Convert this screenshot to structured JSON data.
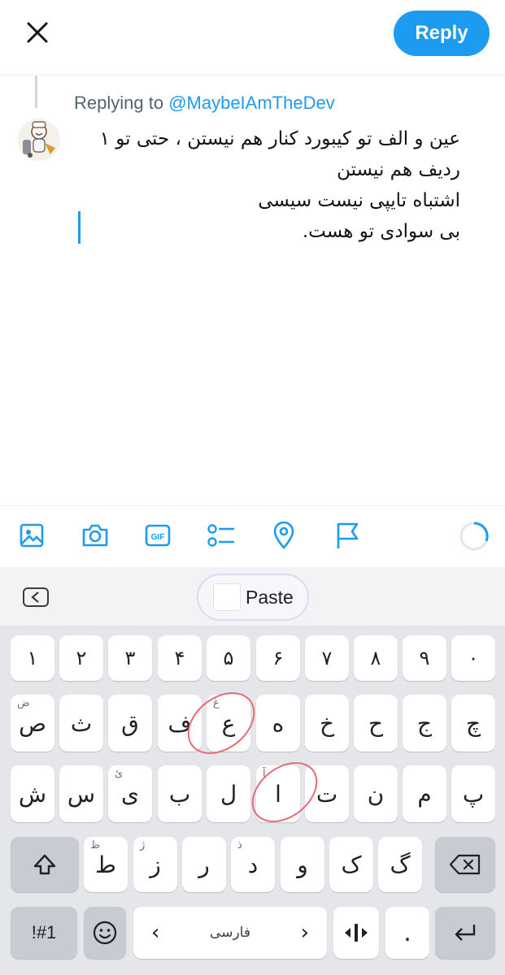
{
  "header": {
    "close_icon": "close-icon",
    "reply_label": "Reply",
    "reply_color": "#1d9bf0"
  },
  "context": {
    "replying_prefix": "Replying to ",
    "replying_handle": "@MaybeIAmTheDev"
  },
  "compose": {
    "lines": [
      "عین و الف تو کیبورد کنار هم نیستن ، حتی تو ۱",
      "ردیف هم نیستن",
      "اشتباه تایپی نیست سیسی",
      "بی سوادی تو هست."
    ]
  },
  "toolbar": {
    "icons": [
      "image-icon",
      "camera-icon",
      "gif-icon",
      "poll-icon",
      "location-icon",
      "flag-icon"
    ],
    "gif_text": "GIF"
  },
  "keyboard": {
    "paste_label": "Paste",
    "number_row": [
      "۱",
      "۲",
      "۳",
      "۴",
      "۵",
      "۶",
      "۷",
      "۸",
      "۹",
      "۰"
    ],
    "row1": [
      "ص",
      "ث",
      "ق",
      "ف",
      "ع",
      "ه",
      "خ",
      "ح",
      "ج",
      "چ"
    ],
    "row1_hints": [
      "ض",
      "",
      "",
      "",
      "غ",
      "",
      "",
      "",
      "",
      ""
    ],
    "row2": [
      "ش",
      "س",
      "ی",
      "ب",
      "ل",
      "ا",
      "ت",
      "ن",
      "م",
      "پ"
    ],
    "row2_hints": [
      "",
      "",
      "ئ",
      "",
      "",
      "آ",
      "",
      "",
      "",
      ""
    ],
    "row3": [
      "ط",
      "ز",
      "ر",
      "د",
      "و",
      "ک",
      "گ"
    ],
    "row3_hints": [
      "ظ",
      "ژ",
      "",
      "ذ",
      "",
      "",
      ""
    ],
    "symbols_label": "!#1",
    "space_label": "فارسی",
    "space_left_arrow": "‹",
    "space_right_arrow": "›",
    "period_label": ".",
    "highlight_color": "#e56a73"
  }
}
